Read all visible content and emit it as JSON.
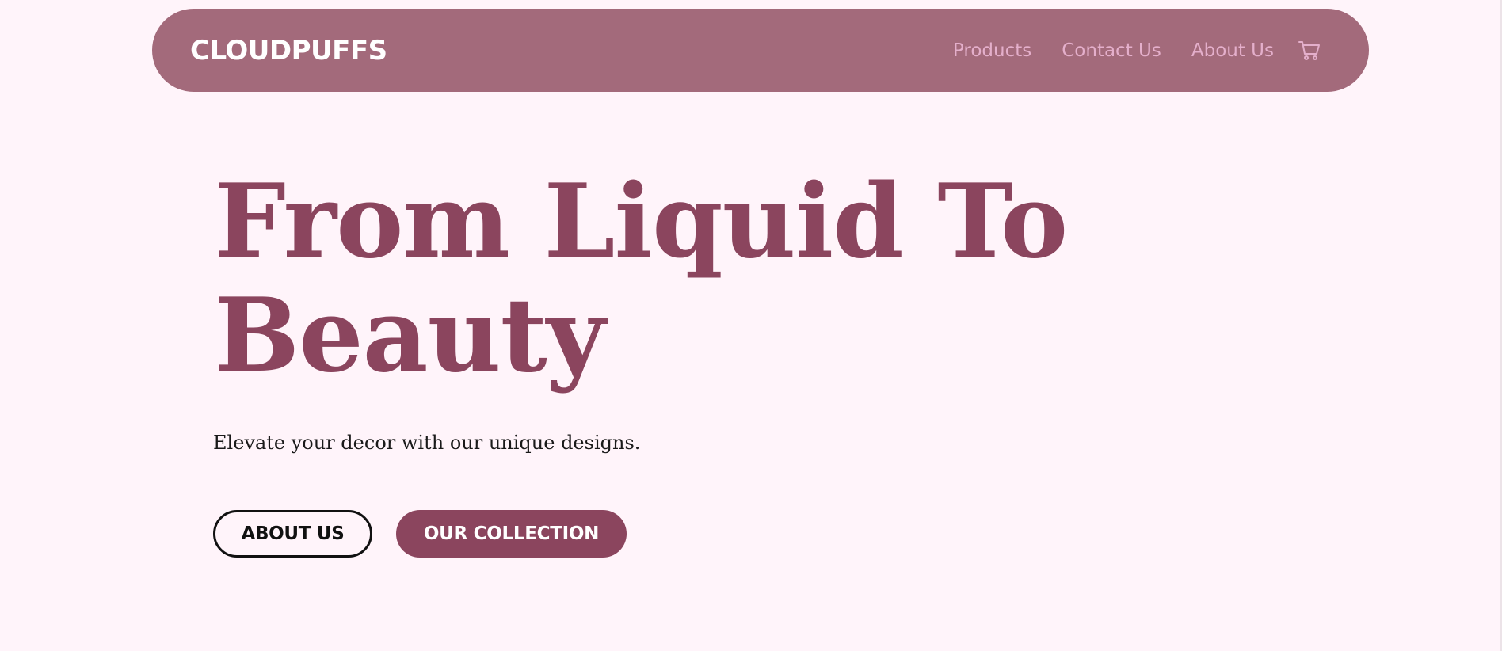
{
  "nav": {
    "logo": "CLOUDPUFFS",
    "links": [
      "Products",
      "Contact Us",
      "About Us"
    ],
    "cart_icon": "shopping-cart-icon"
  },
  "hero": {
    "title_lines": [
      "From Liquid To",
      "Beauty"
    ],
    "subtitle": "Elevate your decor with our unique designs.",
    "buttons": {
      "about": "ABOUT US",
      "collection": "OUR COLLECTION"
    }
  },
  "colors": {
    "background": "#fff4fa",
    "navbar": "#a36a7b",
    "accent": "#8b455e",
    "nav_link": "#e4afcb",
    "logo": "#ffffff"
  }
}
